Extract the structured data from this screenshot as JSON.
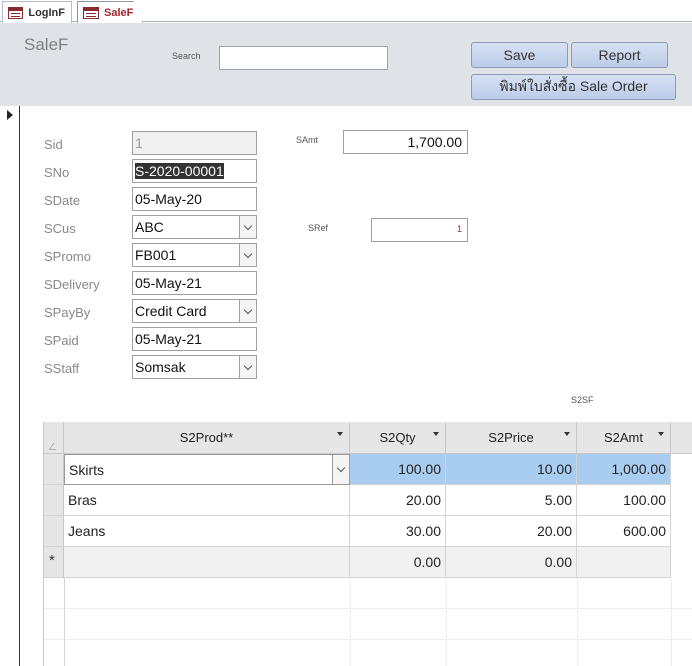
{
  "tabs": [
    {
      "label": "LogInF",
      "icon": "form-icon",
      "active": false
    },
    {
      "label": "SaleF",
      "icon": "form-icon",
      "active": true
    }
  ],
  "header": {
    "title": "SaleF",
    "search_label": "Search",
    "search_value": "",
    "buttons": {
      "save": "Save",
      "report": "Report",
      "print": "พิมพ์ใบสั่งซื้อ Sale Order"
    }
  },
  "fields": {
    "sid": {
      "label": "Sid",
      "value": "1"
    },
    "sno": {
      "label": "SNo",
      "value": "S-2020-00001"
    },
    "sdate": {
      "label": "SDate",
      "value": "05-May-20"
    },
    "scus": {
      "label": "SCus",
      "value": "ABC"
    },
    "spromo": {
      "label": "SPromo",
      "value": "FB001"
    },
    "sdelivery": {
      "label": "SDelivery",
      "value": "05-May-21"
    },
    "spayby": {
      "label": "SPayBy",
      "value": "Credit Card"
    },
    "spaid": {
      "label": "SPaid",
      "value": "05-May-21"
    },
    "sstaff": {
      "label": "SStaff",
      "value": "Somsak"
    },
    "samt": {
      "label": "SAmt",
      "value": "1,700.00"
    },
    "sref": {
      "label": "SRef",
      "value": "1"
    }
  },
  "subform": {
    "label": "S2SF",
    "columns": [
      "S2Prod**",
      "S2Qty",
      "S2Price",
      "S2Amt"
    ],
    "rows": [
      {
        "prod": "Skirts",
        "qty": "100.00",
        "price": "10.00",
        "amt": "1,000.00"
      },
      {
        "prod": "Bras",
        "qty": "20.00",
        "price": "5.00",
        "amt": "100.00"
      },
      {
        "prod": "Jeans",
        "qty": "30.00",
        "price": "20.00",
        "amt": "600.00"
      }
    ],
    "new_row": {
      "marker": "*",
      "prod": "",
      "qty": "0.00",
      "price": "0.00",
      "amt": ""
    }
  }
}
